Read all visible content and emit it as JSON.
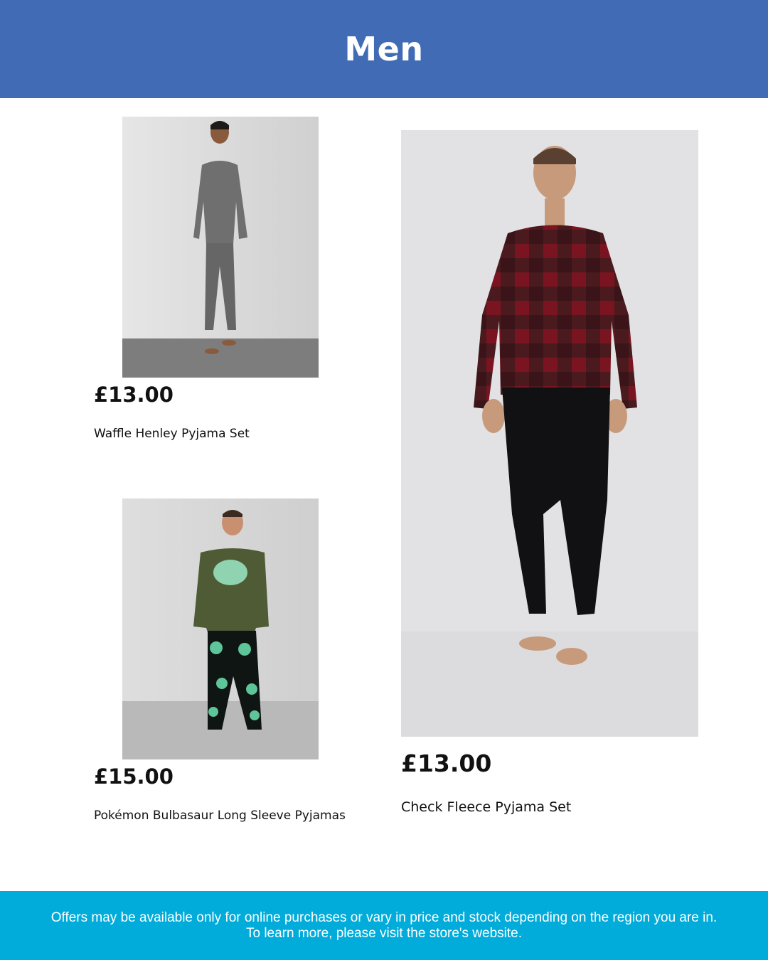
{
  "header": {
    "title": "Men"
  },
  "products": [
    {
      "price": "£13.00",
      "name": "Waffle Henley Pyjama Set",
      "image_icon": "product-photo-grey-waffle-pyjamas"
    },
    {
      "price": "£15.00",
      "name": "Pokémon Bulbasaur Long Sleeve Pyjamas",
      "image_icon": "product-photo-bulbasaur-pyjamas"
    },
    {
      "price": "£13.00",
      "name": "Check Fleece Pyjama Set",
      "image_icon": "product-photo-red-check-fleece-pyjamas"
    }
  ],
  "footer": {
    "line1": "Offers may be available only for online purchases or vary in price and stock depending on the region you are in.",
    "line2": "To learn more, please visit the store's website."
  },
  "colors": {
    "header_bg": "#416cb5",
    "footer_bg": "#01acdb"
  }
}
